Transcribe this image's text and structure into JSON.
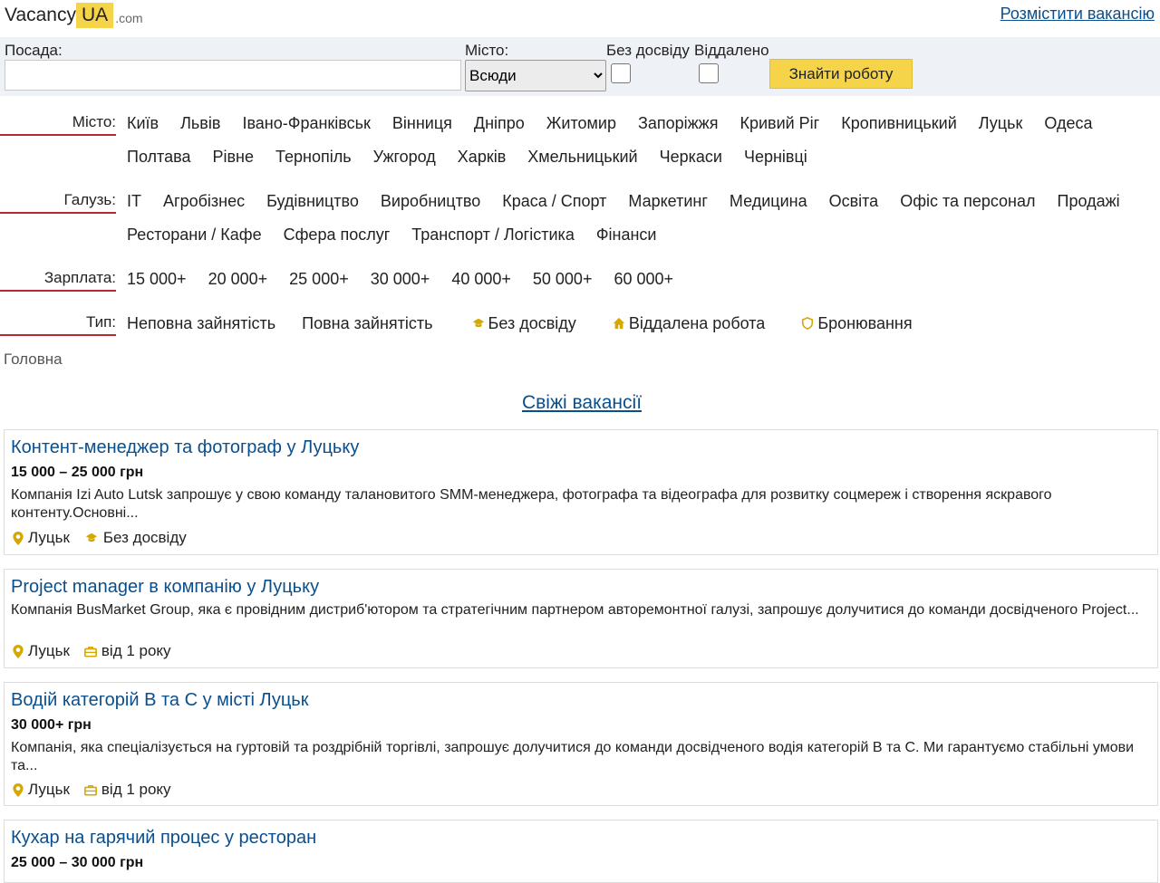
{
  "header": {
    "logo_a": "Vacancy",
    "logo_b": "UA",
    "logo_c": ".com",
    "post_link": "Розмістити вакансію"
  },
  "search": {
    "position_label": "Посада:",
    "position_value": "",
    "city_label": "Місто:",
    "city_selected": "Всюди",
    "no_exp_label": "Без досвіду",
    "remote_label": "Віддалено",
    "find_button": "Знайти роботу"
  },
  "filters": {
    "city": {
      "label": "Місто:",
      "line1": [
        "Київ",
        "Львів",
        "Івано-Франківськ",
        "Вінниця",
        "Дніпро",
        "Житомир",
        "Запоріжжя",
        "Кривий Ріг",
        "Кропивницький",
        "Луцьк",
        "Одеса"
      ],
      "line2": [
        "Полтава",
        "Рівне",
        "Тернопіль",
        "Ужгород",
        "Харків",
        "Хмельницький",
        "Черкаси",
        "Чернівці"
      ]
    },
    "industry": {
      "label": "Галузь:",
      "line1": [
        "IT",
        "Агробізнес",
        "Будівництво",
        "Виробництво",
        "Краса / Спорт",
        "Маркетинг",
        "Медицина",
        "Освіта",
        "Офіс та персонал",
        "Продажі"
      ],
      "line2": [
        "Ресторани / Кафе",
        "Сфера послуг",
        "Транспорт / Логістика",
        "Фінанси"
      ]
    },
    "salary": {
      "label": "Зарплата:",
      "items": [
        "15 000+",
        "20 000+",
        "25 000+",
        "30 000+",
        "40 000+",
        "50 000+",
        "60 000+"
      ]
    },
    "type": {
      "label": "Тип:",
      "part_time": "Неповна зайнятість",
      "full_time": "Повна зайнятість",
      "no_exp": "Без досвіду",
      "remote": "Віддалена робота",
      "reservation": "Бронювання"
    }
  },
  "breadcrumb": "Головна",
  "fresh_title": "Свіжі вакансії",
  "jobs": [
    {
      "title": "Контент-менеджер та фотограф у Луцьку",
      "salary": "15 000 – 25 000 грн",
      "desc": "Компанія Izi Auto Lutsk запрошує у свою команду талановитого SMM-менеджера, фотографа та відеографа для розвитку соцмереж і створення яскравого контенту.Основні...",
      "city": "Луцьк",
      "tag": "Без досвіду"
    },
    {
      "title": "Project manager в компанію у Луцьку",
      "salary": "",
      "desc": "Компанія BusMarket Group, яка є провідним дистриб'ютором та стратегічним партнером авторемонтної галузі, запрошує долучитися до команди досвідченого Project...",
      "city": "Луцьк",
      "tag": "від 1 року"
    },
    {
      "title": "Водій категорій В та С у місті Луцьк",
      "salary": "30 000+ грн",
      "desc": "Компанія, яка спеціалізується на гуртовій та роздрібній торгівлі, запрошує долучитися до команди досвідченого водія категорій В та С. Ми гарантуємо стабільні умови та...",
      "city": "Луцьк",
      "tag": "від 1 року"
    },
    {
      "title": "Кухар на гарячий процес у ресторан",
      "salary": "25 000 – 30 000 грн"
    }
  ],
  "colors": {
    "accent": "#f5d44a",
    "link": "#0a4f8c",
    "label_underline": "#b9282f",
    "icon": "#d4a800"
  }
}
